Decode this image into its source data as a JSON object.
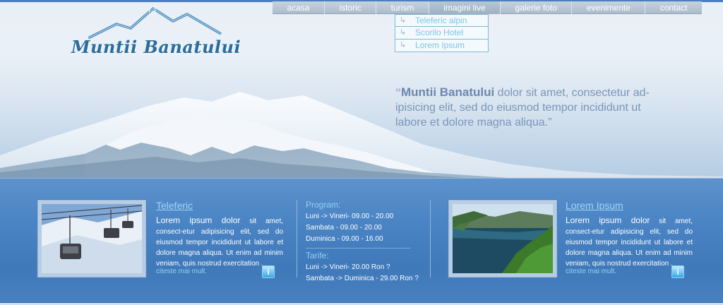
{
  "logo": {
    "text": "Muntii Banatului"
  },
  "nav": {
    "items": [
      {
        "label": "acasa"
      },
      {
        "label": "istoric"
      },
      {
        "label": "turism"
      },
      {
        "label": "imagini live"
      },
      {
        "label": "galerie foto"
      },
      {
        "label": "evenimente"
      },
      {
        "label": "contact"
      }
    ],
    "submenu": [
      {
        "label": "Teleferic alpin"
      },
      {
        "label": "Scorilo Hotel"
      },
      {
        "label": "Lorem Ipsum"
      }
    ]
  },
  "quote": {
    "open_mark": "“",
    "strong": "Muntii Banatului",
    "text": " dolor sit amet, consectetur ad-ipisicing elit, sed do eiusmod tempor incididunt ut labore et dolore magna aliqua.”"
  },
  "left_panel": {
    "title": "Teleferic",
    "lead": "Lorem ipsum dolor",
    "body": " sit amet, consect-etur adipisicing elit, sed do eiusmod tempor incididunt ut labore et dolore magna aliqua. Ut enim ad minim veniam, quis nostrud exercitation .",
    "more": "citeste mai mult."
  },
  "schedule": {
    "program_heading": "Program:",
    "program": [
      "Luni -> Vineri- 09.00 - 20.00",
      "Sambata - 09.00 - 20.00",
      "Duminica - 09.00 - 16.00"
    ],
    "tarife_heading": "Tarife:",
    "tarife": [
      "Luni -> Vineri- 20.00 Ron ?",
      "Sambata -> Duminica - 29.00 Ron ?"
    ]
  },
  "right_panel": {
    "title": "Lorem Ipsum",
    "lead": "Lorem ipsum dolor",
    "body": " sit amet, consect-etur adipisicing elit, sed do eiusmod tempor incididunt ut labore et dolore magna aliqua. Ut enim ad minim veniam, quis nostrud exercitation .",
    "more": "citeste mai mult."
  },
  "colors": {
    "band": "#4a84c4",
    "link": "#9ed7f6",
    "logo_text": "#2b6d9a"
  },
  "icons": {
    "info": "info-icon",
    "submenu_arrow": "submenu-arrow-icon"
  }
}
